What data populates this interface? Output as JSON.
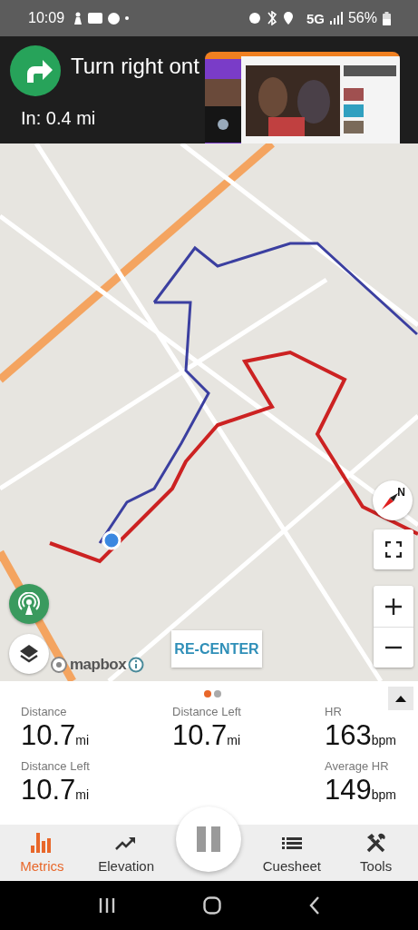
{
  "status_bar": {
    "time": "10:09",
    "network": "5G",
    "battery": "56%"
  },
  "instruction": {
    "title": "Turn right ont",
    "distance": "In: 0.4 mi"
  },
  "map": {
    "compass_label": "N",
    "attribution": "mapbox",
    "recenter_button": "RE-CENTER"
  },
  "pager": [
    {
      "selected": true
    },
    {
      "selected": false
    }
  ],
  "metric_rows": [
    [
      {
        "kind": "metric",
        "label": "Distance",
        "value": "10.7",
        "unit": "mi"
      },
      {
        "kind": "metric",
        "label": "Distance Left",
        "value": "10.7",
        "unit": "mi"
      },
      {
        "kind": "metric",
        "label": "HR",
        "value": "163",
        "unit": "bpm"
      }
    ],
    [
      {
        "kind": "metric",
        "label": "Distance Left",
        "value": "10.7",
        "unit": "mi"
      },
      {
        "kind": "empty"
      },
      {
        "kind": "metric",
        "label": "Average HR",
        "value": "149",
        "unit": "bpm"
      }
    ]
  ],
  "tabs": [
    {
      "label": "Metrics",
      "kind": "metrics",
      "selected": true
    },
    {
      "label": "Elevation",
      "kind": "elevation",
      "selected": false
    },
    {
      "label": "Cuesheet",
      "kind": "cuesheet",
      "selected": false
    },
    {
      "label": "Tools",
      "kind": "tools",
      "selected": false
    }
  ]
}
